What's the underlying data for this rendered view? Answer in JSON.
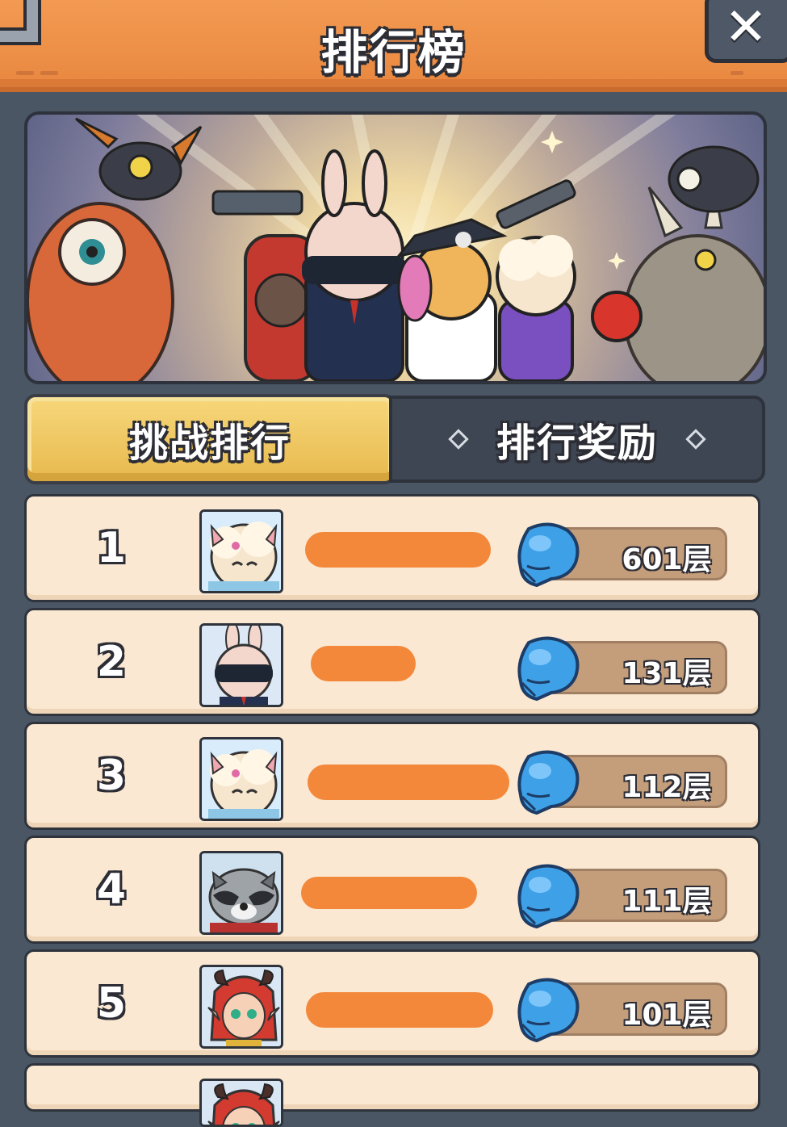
{
  "header": {
    "title": "排行榜",
    "close_label": "✕"
  },
  "tabs": [
    {
      "label": "挑战排行",
      "active": true
    },
    {
      "label": "排行奖励",
      "active": false
    }
  ],
  "leaderboard": [
    {
      "rank": "1",
      "avatar": "sheep-girl-avatar",
      "score": "601层"
    },
    {
      "rank": "2",
      "avatar": "bunny-agent-avatar",
      "score": "131层"
    },
    {
      "rank": "3",
      "avatar": "sheep-girl-avatar",
      "score": "112层"
    },
    {
      "rank": "4",
      "avatar": "raccoon-avatar",
      "score": "111层"
    },
    {
      "rank": "5",
      "avatar": "red-hair-elf-avatar",
      "score": "101层"
    }
  ],
  "colors": {
    "header": "#f39a52",
    "tab_active": "#f2c95f",
    "row_bg": "#fbe8d2",
    "score_pill": "#c49d7b",
    "redaction": "#f3883a",
    "glove": "#3ea0e6"
  }
}
